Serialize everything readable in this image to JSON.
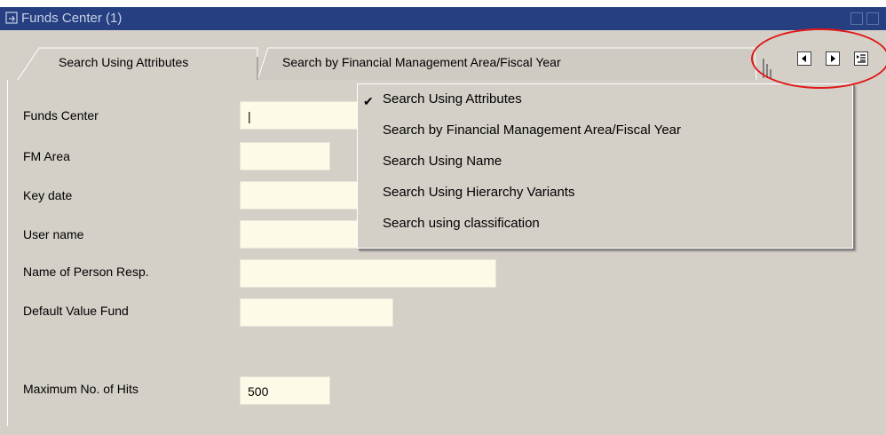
{
  "window": {
    "title": "Funds Center (1)"
  },
  "tabs": [
    {
      "label": "Search Using Attributes",
      "active": true
    },
    {
      "label": "Search by Financial Management Area/Fiscal Year",
      "active": false
    }
  ],
  "form": {
    "fields": [
      {
        "label": "Funds Center",
        "value": "|"
      },
      {
        "label": "FM Area",
        "value": ""
      },
      {
        "label": "Key date",
        "value": ""
      },
      {
        "label": "User name",
        "value": ""
      },
      {
        "label": "Name of Person Resp.",
        "value": ""
      },
      {
        "label": "Default Value Fund",
        "value": ""
      },
      {
        "label": "Maximum No. of Hits",
        "value": "500"
      }
    ]
  },
  "menu": {
    "checkmark": "✔",
    "items": [
      {
        "label": "Search Using Attributes",
        "checked": true
      },
      {
        "label": "Search by Financial Management Area/Fiscal Year"
      },
      {
        "label": "Search Using Name"
      },
      {
        "label": "Search Using Hierarchy Variants"
      },
      {
        "label": "Search using classification"
      }
    ]
  },
  "icons": {
    "title": "window-icon",
    "scroll_left": "arrow-left-icon",
    "scroll_right": "arrow-right-icon",
    "tab_list": "tab-list-icon"
  },
  "colors": {
    "titlebar": "#253f80",
    "panel": "#d4d0c8",
    "field": "#fdfbe7",
    "annotation": "#e01818"
  }
}
